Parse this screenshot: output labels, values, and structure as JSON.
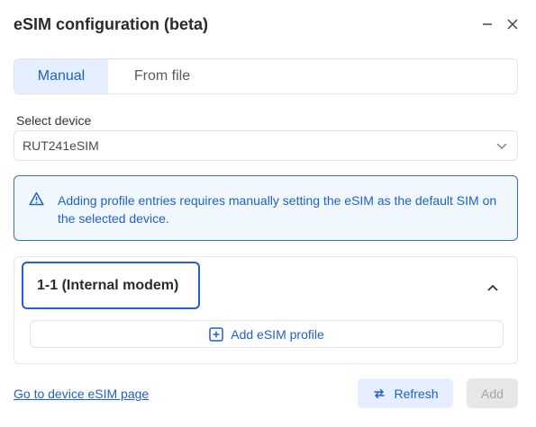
{
  "window": {
    "title": "eSIM configuration (beta)",
    "minimize_icon": "minimize-icon",
    "close_icon": "close-icon"
  },
  "tabs": [
    {
      "label": "Manual",
      "active": true
    },
    {
      "label": "From file",
      "active": false
    }
  ],
  "device_select": {
    "label": "Select device",
    "value": "RUT241eSIM"
  },
  "alert": {
    "icon": "warning-icon",
    "message": "Adding profile entries requires manually setting the eSIM as the default SIM on the selected device."
  },
  "modem_panel": {
    "title": "1-1 (Internal modem)",
    "expanded": true,
    "add_profile_label": "Add eSIM profile"
  },
  "footer": {
    "link_label": "Go to device eSIM page",
    "refresh_label": "Refresh",
    "add_label": "Add"
  },
  "colors": {
    "accent": "#1f5fd1",
    "accent_bg": "#e6efff",
    "alert_bg": "#f1f7ff",
    "disabled_bg": "#e7e7e7",
    "disabled_text": "#a6a6a6"
  }
}
